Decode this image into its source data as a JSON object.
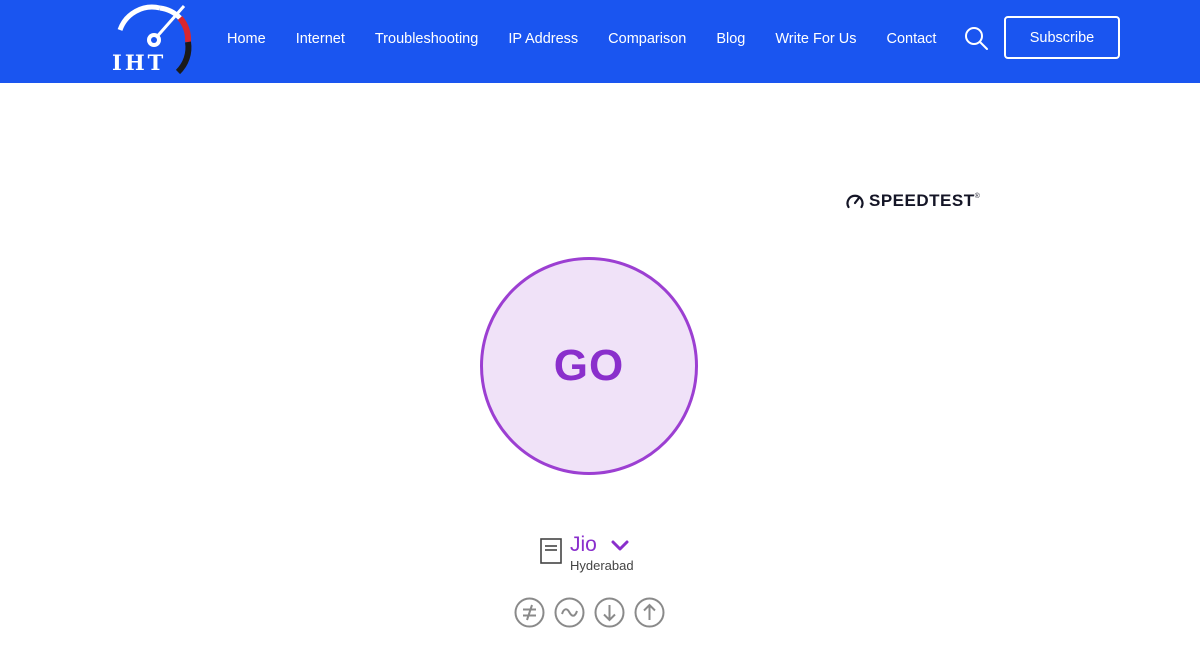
{
  "header": {
    "logo_text": "IHT",
    "nav": [
      "Home",
      "Internet",
      "Troubleshooting",
      "IP Address",
      "Comparison",
      "Blog",
      "Write For Us",
      "Contact"
    ],
    "subscribe_label": "Subscribe",
    "search_icon": "search-icon"
  },
  "speedtest": {
    "brand": "SPEEDTEST",
    "go_label": "GO",
    "provider": "Jio",
    "location": "Hyderabad",
    "metric_icons": [
      "ping-icon",
      "jitter-icon",
      "download-icon",
      "upload-icon"
    ]
  },
  "colors": {
    "nav_bg": "#1a55f0",
    "accent_purple": "#8a2fcc",
    "go_fill": "#f0e2f8",
    "icon_gray": "#8a8a8a"
  }
}
